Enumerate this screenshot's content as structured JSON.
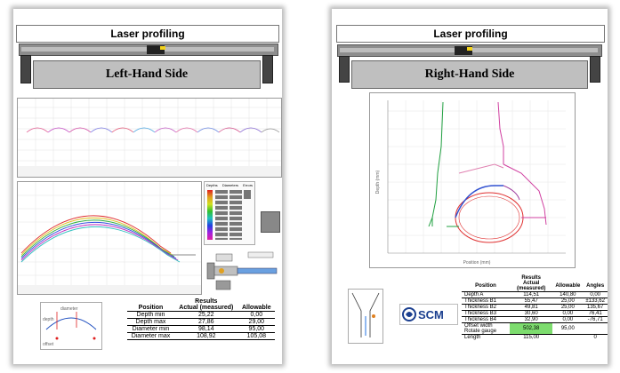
{
  "left": {
    "title": "Laser profiling",
    "side_label": "Left-Hand Side",
    "legend_headers": [
      "Depths",
      "Diameters",
      "Errors"
    ],
    "results": {
      "header": "Results",
      "columns": [
        "Position",
        "Actual (measured)",
        "Allowable"
      ],
      "rows": [
        {
          "position": "Depth min",
          "actual": "25,22",
          "allowable": "0,00"
        },
        {
          "position": "Depth max",
          "actual": "27,86",
          "allowable": "29,00"
        },
        {
          "position": "Diameter min",
          "actual": "98,14",
          "allowable": "95,00"
        },
        {
          "position": "Diameter max",
          "actual": "108,92",
          "allowable": "105,08"
        }
      ]
    },
    "diagram_labels": [
      "diameter",
      "depth",
      "offset"
    ]
  },
  "right": {
    "title": "Laser profiling",
    "side_label": "Right-Hand Side",
    "chart_xlabel": "Position (mm)",
    "chart_ylabel": "Depth (mm)",
    "logo_text": "SCM",
    "results": {
      "header": "Results",
      "columns": [
        "Position",
        "Actual (measured)",
        "Allowable",
        "Angles"
      ],
      "rows": [
        {
          "position": "Depth A",
          "actual": "114,51",
          "allowable": "140,80",
          "angle": "0,00"
        },
        {
          "position": "Thickness B1",
          "actual": "55,47",
          "allowable": "25,00",
          "angle": "±133,62"
        },
        {
          "position": "Thickness B2",
          "actual": "49,81",
          "allowable": "25,00",
          "angle": "135,67"
        },
        {
          "position": "Thickness B3",
          "actual": "30,60",
          "allowable": "0,00",
          "angle": "76,41"
        },
        {
          "position": "Thickness B4",
          "actual": "32,90",
          "allowable": "0,00",
          "angle": "-76,71"
        },
        {
          "position": "Offset width Rotate gauge",
          "actual": "502,38",
          "allowable": "95,00",
          "angle": ""
        },
        {
          "position": "Length",
          "actual": "115,00",
          "allowable": "",
          "angle": "0"
        }
      ]
    }
  },
  "colors": {
    "rail": "#8d8d8d",
    "side_box": "#bfbfbf",
    "highlight_green": "#7ddc6e",
    "scm_blue": "#1b3f8f"
  }
}
